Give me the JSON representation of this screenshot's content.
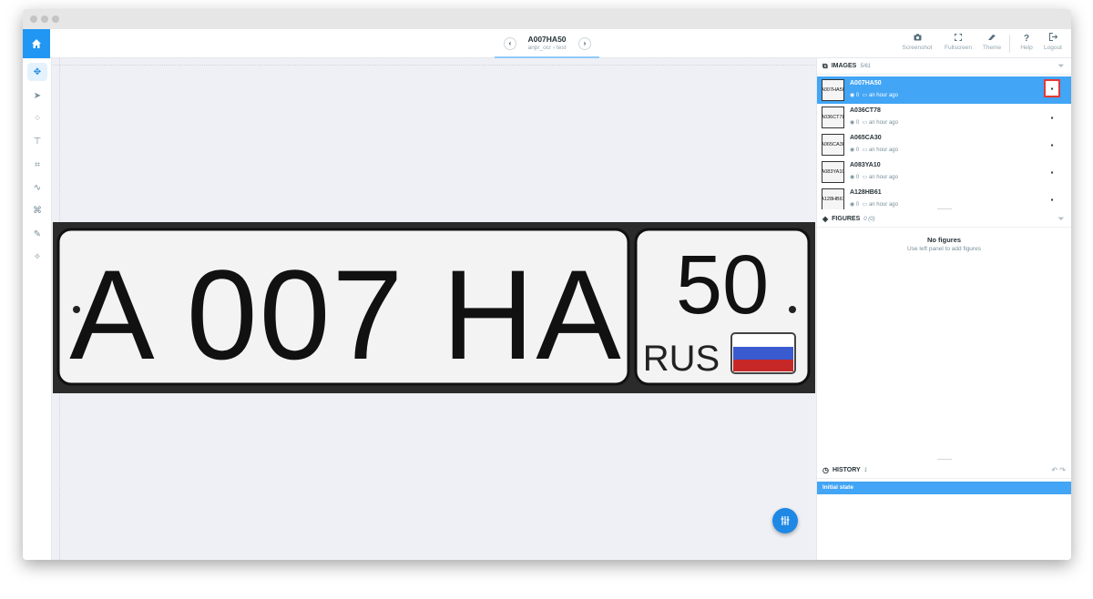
{
  "header": {
    "title": "A007HA50",
    "breadcrumb_project": "anpr_ocr",
    "breadcrumb_sep": "›",
    "breadcrumb_dataset": "test",
    "tools": [
      {
        "label": "Screenshot",
        "icon": "camera-icon"
      },
      {
        "label": "Fullscreen",
        "icon": "fullscreen-icon"
      },
      {
        "label": "Theme",
        "icon": "theme-icon"
      },
      {
        "label": "Help",
        "icon": "help-icon"
      },
      {
        "label": "Logout",
        "icon": "logout-icon"
      }
    ]
  },
  "left_tools": [
    "move-tool",
    "select-tool",
    "point-tool",
    "line-tool",
    "rectangle-tool",
    "polyline-tool",
    "polygon-tool",
    "brush-tool",
    "magic-wand-tool"
  ],
  "plate": {
    "number": "A 007 HA",
    "region": "50",
    "country": "RUS",
    "flag_colors": [
      "#ffffff",
      "#2a4dbd",
      "#c62828"
    ]
  },
  "images_panel": {
    "title": "IMAGES",
    "count": "5/61",
    "items": [
      {
        "name": "A007HA50",
        "comments": "0",
        "time": "an hour ago",
        "thumb": "A007HA50",
        "selected": true
      },
      {
        "name": "A036CT78",
        "comments": "0",
        "time": "an hour ago",
        "thumb": "A036CT78",
        "selected": false
      },
      {
        "name": "A065CA30",
        "comments": "0",
        "time": "an hour ago",
        "thumb": "A065CA30",
        "selected": false
      },
      {
        "name": "A083YA10",
        "comments": "0",
        "time": "an hour ago",
        "thumb": "A083YA10",
        "selected": false
      },
      {
        "name": "A128HB61",
        "comments": "0",
        "time": "an hour ago",
        "thumb": "A128HB61",
        "selected": false
      }
    ]
  },
  "figures_panel": {
    "title": "FIGURES",
    "count": "0 (0)",
    "empty_title": "No figures",
    "empty_hint": "Use left panel to add figures"
  },
  "history_panel": {
    "title": "HISTORY",
    "count": "1",
    "items": [
      "Initial state"
    ]
  },
  "colors": {
    "accent": "#2196f3",
    "selected_row": "#42a5f5",
    "highlight": "#e53935"
  }
}
